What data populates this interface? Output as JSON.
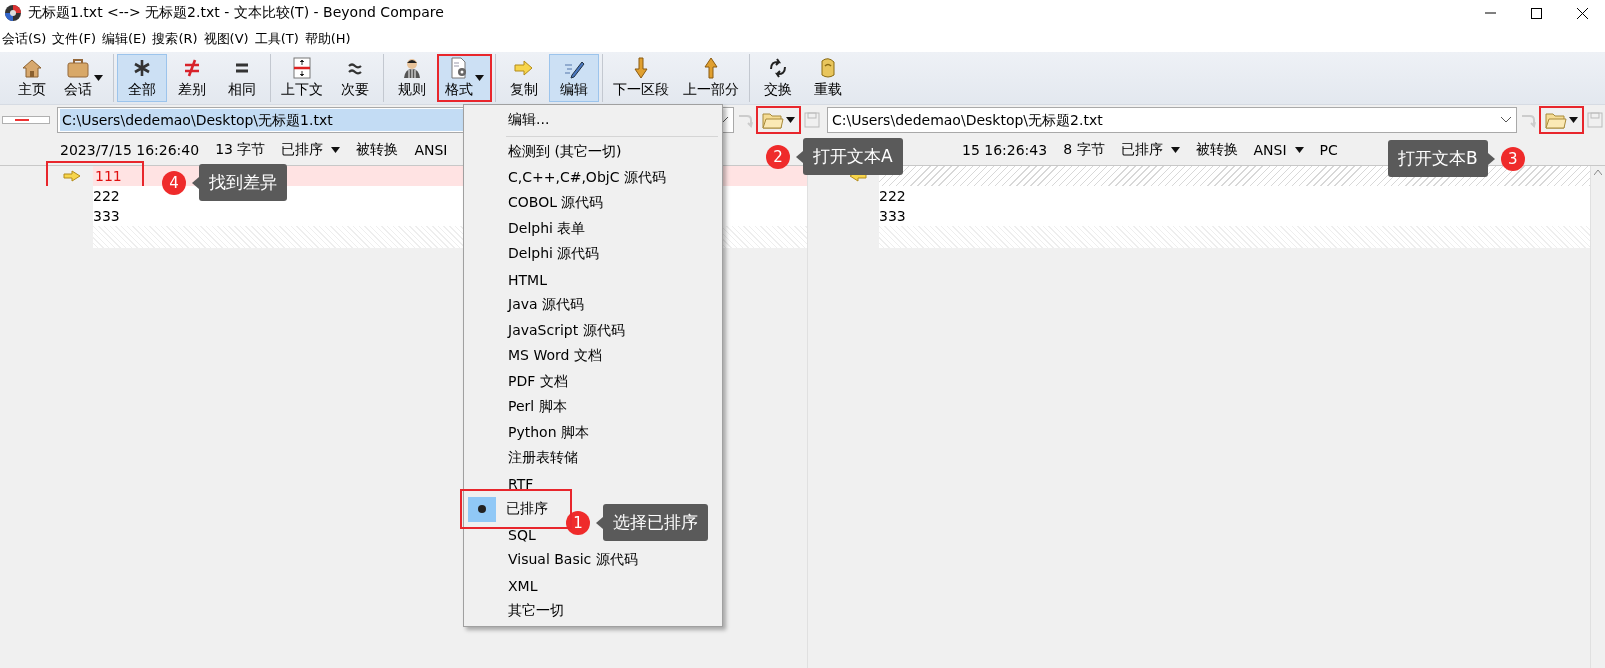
{
  "window": {
    "title": "无标题1.txt <--> 无标题2.txt - 文本比较(T) - Beyond Compare"
  },
  "menu_bar": [
    "会话(S)",
    "文件(F)",
    "编辑(E)",
    "搜索(R)",
    "视图(V)",
    "工具(T)",
    "帮助(H)"
  ],
  "toolbar": [
    [
      {
        "label": "主页",
        "kind": "home",
        "selected": false,
        "dropdown": false,
        "highlighted": false
      },
      {
        "label": "会话",
        "kind": "briefcase",
        "selected": false,
        "dropdown": true,
        "highlighted": false
      }
    ],
    [
      {
        "label": "全部",
        "kind": "asterisk",
        "selected": true,
        "dropdown": false,
        "highlighted": false
      },
      {
        "label": "差别",
        "kind": "notequal",
        "selected": false,
        "dropdown": false,
        "highlighted": false
      },
      {
        "label": "相同",
        "kind": "equal",
        "selected": false,
        "dropdown": false,
        "highlighted": false
      }
    ],
    [
      {
        "label": "上下文",
        "kind": "context",
        "selected": false,
        "dropdown": false,
        "highlighted": false
      },
      {
        "label": "次要",
        "kind": "approx",
        "selected": false,
        "dropdown": false,
        "highlighted": false
      }
    ],
    [
      {
        "label": "规则",
        "kind": "referee",
        "selected": false,
        "dropdown": false,
        "highlighted": false
      },
      {
        "label": "格式",
        "kind": "format",
        "selected": true,
        "dropdown": true,
        "highlighted": true
      }
    ],
    [
      {
        "label": "复制",
        "kind": "copy",
        "selected": false,
        "dropdown": false,
        "highlighted": false
      },
      {
        "label": "编辑",
        "kind": "edit",
        "selected": true,
        "dropdown": false,
        "highlighted": false
      }
    ],
    [
      {
        "label": "下一区段",
        "kind": "down",
        "selected": false,
        "dropdown": false,
        "highlighted": false
      },
      {
        "label": "上一部分",
        "kind": "up",
        "selected": false,
        "dropdown": false,
        "highlighted": false
      }
    ],
    [
      {
        "label": "交换",
        "kind": "swap",
        "selected": false,
        "dropdown": false,
        "highlighted": false
      },
      {
        "label": "重载",
        "kind": "reload",
        "selected": false,
        "dropdown": false,
        "highlighted": false
      }
    ]
  ],
  "panes": [
    {
      "path": "C:\\Users\\dedemao\\Desktop\\无标题1.txt",
      "path_selected": true,
      "open_highlighted": true,
      "info": [
        {
          "text": "2023/7/15 16:26:40",
          "dropdown": false
        },
        {
          "text": "13 字节",
          "dropdown": false
        },
        {
          "text": "已排序",
          "dropdown": true
        },
        {
          "text": "被转换",
          "dropdown": false
        },
        {
          "text": "ANSI",
          "dropdown": false
        }
      ],
      "lines": [
        {
          "kind": "changed",
          "text": "111",
          "marker": true,
          "highlighted": true
        },
        {
          "kind": "same",
          "text": "222",
          "marker": false,
          "highlighted": false
        },
        {
          "kind": "same",
          "text": "333",
          "marker": false,
          "highlighted": false
        }
      ]
    },
    {
      "path": "C:\\Users\\dedemao\\Desktop\\无标题2.txt",
      "path_selected": false,
      "open_highlighted": true,
      "info": [
        {
          "text": "15 16:26:43",
          "dropdown": false
        },
        {
          "text": "8 字节",
          "dropdown": false
        },
        {
          "text": "已排序",
          "dropdown": true
        },
        {
          "text": "被转换",
          "dropdown": false
        },
        {
          "text": "ANSI",
          "dropdown": true
        },
        {
          "text": "PC",
          "dropdown": false
        }
      ],
      "lines": [
        {
          "kind": "missing",
          "marker": true,
          "highlighted": false
        },
        {
          "kind": "same",
          "text": "222",
          "marker": false,
          "highlighted": false
        },
        {
          "kind": "same",
          "text": "333",
          "marker": false,
          "highlighted": false
        }
      ]
    }
  ],
  "format_menu": [
    [
      {
        "label": "编辑...",
        "selected": false
      }
    ],
    [
      {
        "label": "检测到 (其它一切)",
        "selected": false
      },
      {
        "label": "C,C++,C#,ObjC 源代码",
        "selected": false
      },
      {
        "label": "COBOL 源代码",
        "selected": false
      },
      {
        "label": "Delphi 表单",
        "selected": false
      },
      {
        "label": "Delphi 源代码",
        "selected": false
      },
      {
        "label": "HTML",
        "selected": false
      },
      {
        "label": "Java 源代码",
        "selected": false
      },
      {
        "label": "JavaScript 源代码",
        "selected": false
      },
      {
        "label": "MS Word 文档",
        "selected": false
      },
      {
        "label": "PDF 文档",
        "selected": false
      },
      {
        "label": "Perl 脚本",
        "selected": false
      },
      {
        "label": "Python 脚本",
        "selected": false
      },
      {
        "label": "注册表转储",
        "selected": false
      },
      {
        "label": "RTF",
        "selected": false
      },
      {
        "label": "已排序",
        "selected": true
      },
      {
        "label": "SQL",
        "selected": false
      },
      {
        "label": "Visual Basic 源代码",
        "selected": false
      },
      {
        "label": "XML",
        "selected": false
      },
      {
        "label": "其它一切",
        "selected": false
      }
    ]
  ],
  "annotations": [
    {
      "number": "1",
      "text": "选择已排序",
      "pointer_right": false
    },
    {
      "number": "2",
      "text": "打开文本A",
      "pointer_right": false
    },
    {
      "number": "3",
      "text": "打开文本B",
      "pointer_right": true
    },
    {
      "number": "4",
      "text": "找到差异",
      "pointer_right": false
    }
  ]
}
